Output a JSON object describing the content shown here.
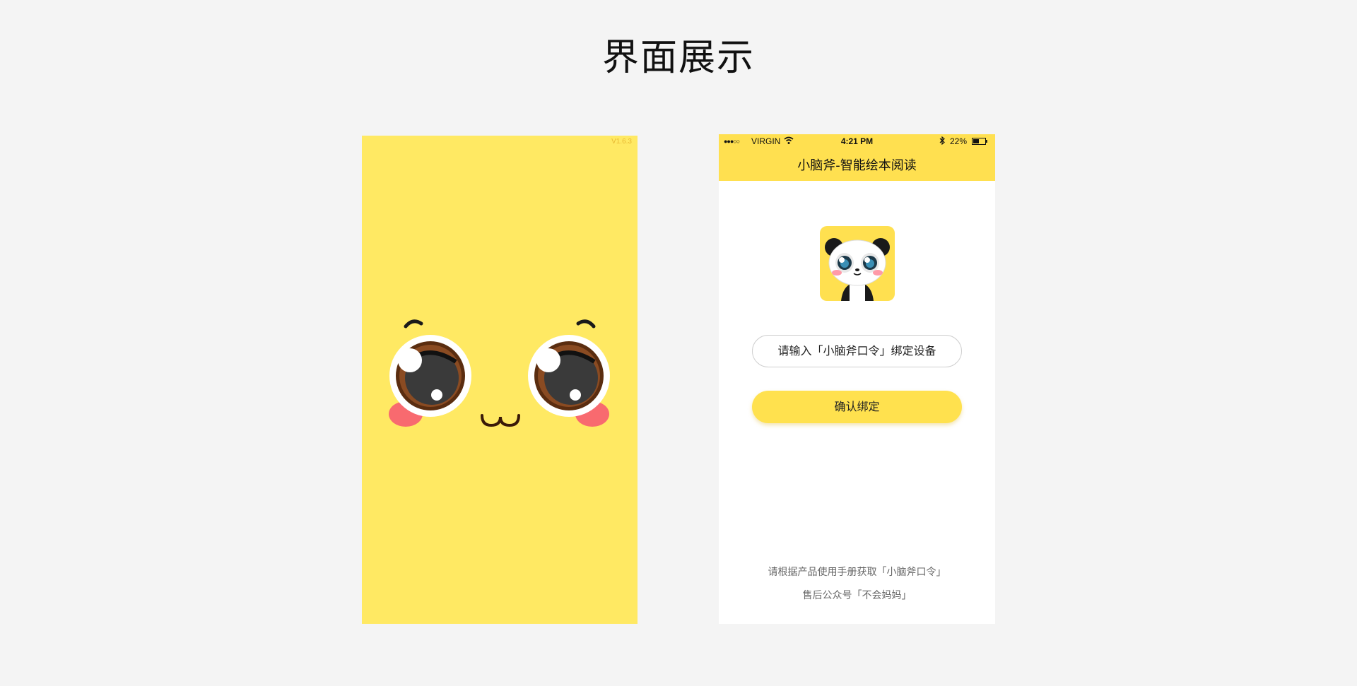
{
  "page": {
    "title": "界面展示"
  },
  "splash": {
    "version": "V1.6.3",
    "background_color": "#ffe963"
  },
  "phone": {
    "status_bar": {
      "signal": "●●●○○",
      "carrier": "VIRGIN",
      "time": "4:21 PM",
      "battery_percent": "22%"
    },
    "app_title": "小脑斧-智能绘本阅读",
    "code_input": {
      "placeholder": "请输入「小脑斧口令」绑定设备"
    },
    "confirm_button_label": "确认绑定",
    "help_lines": [
      "请根据产品使用手册获取「小脑斧口令」",
      "售后公众号「不会妈妈」"
    ],
    "header_color": "#ffe050",
    "button_color": "#ffe14e"
  }
}
